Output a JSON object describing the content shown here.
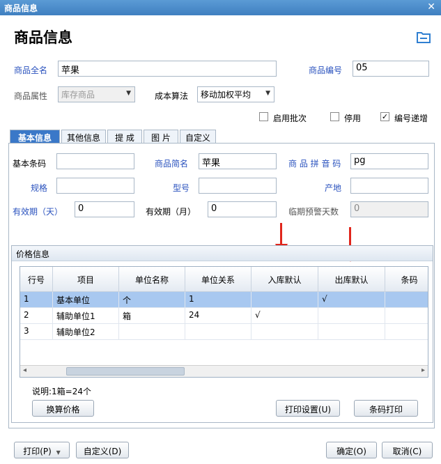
{
  "window": {
    "title": "商品信息",
    "close_glyph": "✕"
  },
  "page_title": "商品信息",
  "form": {
    "full_name_label": "商品全名",
    "full_name_value": "苹果",
    "code_label": "商品编号",
    "code_value": "05",
    "attr_label": "商品属性",
    "attr_value": "库存商品",
    "cost_label": "成本算法",
    "cost_value": "移动加权平均",
    "enable_batch_label": "启用批次",
    "enable_batch_checked": false,
    "disable_label": "停用",
    "disable_checked": false,
    "auto_code_label": "编号递增",
    "auto_code_checked": true,
    "check_glyph": "✓"
  },
  "tabs": [
    {
      "label": "基本信息",
      "active": true
    },
    {
      "label": "其他信息",
      "active": false
    },
    {
      "label": "提 成",
      "active": false
    },
    {
      "label": "图 片",
      "active": false
    },
    {
      "label": "自定义",
      "active": false
    }
  ],
  "basic": {
    "barcode_label": "基本条码",
    "barcode_value": "",
    "short_name_label": "商品简名",
    "short_name_value": "苹果",
    "pinyin_label": "商 品 拼 音 码",
    "pinyin_value": "pg",
    "spec_label": "规格",
    "spec_value": "",
    "model_label": "型号",
    "model_value": "",
    "origin_label": "产地",
    "origin_value": "",
    "valid_days_label": "有效期（天）",
    "valid_days_value": "0",
    "valid_months_label": "有效期（月）",
    "valid_months_value": "0",
    "warn_days_label": "临期预警天数",
    "warn_days_value": "0"
  },
  "price": {
    "group_title": "价格信息",
    "columns": [
      "行号",
      "项目",
      "单位名称",
      "单位关系",
      "入库默认",
      "出库默认",
      "条码"
    ],
    "rows": [
      {
        "no": "1",
        "item": "基本单位",
        "unit": "个",
        "relation": "1",
        "in_default": "",
        "out_default": "√",
        "barcode": "",
        "selected": true
      },
      {
        "no": "2",
        "item": "辅助单位1",
        "unit": "箱",
        "relation": "24",
        "in_default": "√",
        "out_default": "",
        "barcode": "",
        "selected": false
      },
      {
        "no": "3",
        "item": "辅助单位2",
        "unit": "",
        "relation": "",
        "in_default": "",
        "out_default": "",
        "barcode": "",
        "selected": false
      }
    ],
    "note": "说明:1箱=24个",
    "convert_button": "换算价格",
    "print_setup_button": "打印设置(U)",
    "barcode_print_button": "条码打印"
  },
  "footer": {
    "print_button": "打印(P)",
    "custom_button": "自定义(D)",
    "ok_button": "确定(O)",
    "cancel_button": "取消(C)"
  },
  "colors": {
    "accent": "#3a78c8",
    "title_bar": "#4a8bcb",
    "selection": "#a8c8f0",
    "annotation_arrow": "#e0261c"
  }
}
